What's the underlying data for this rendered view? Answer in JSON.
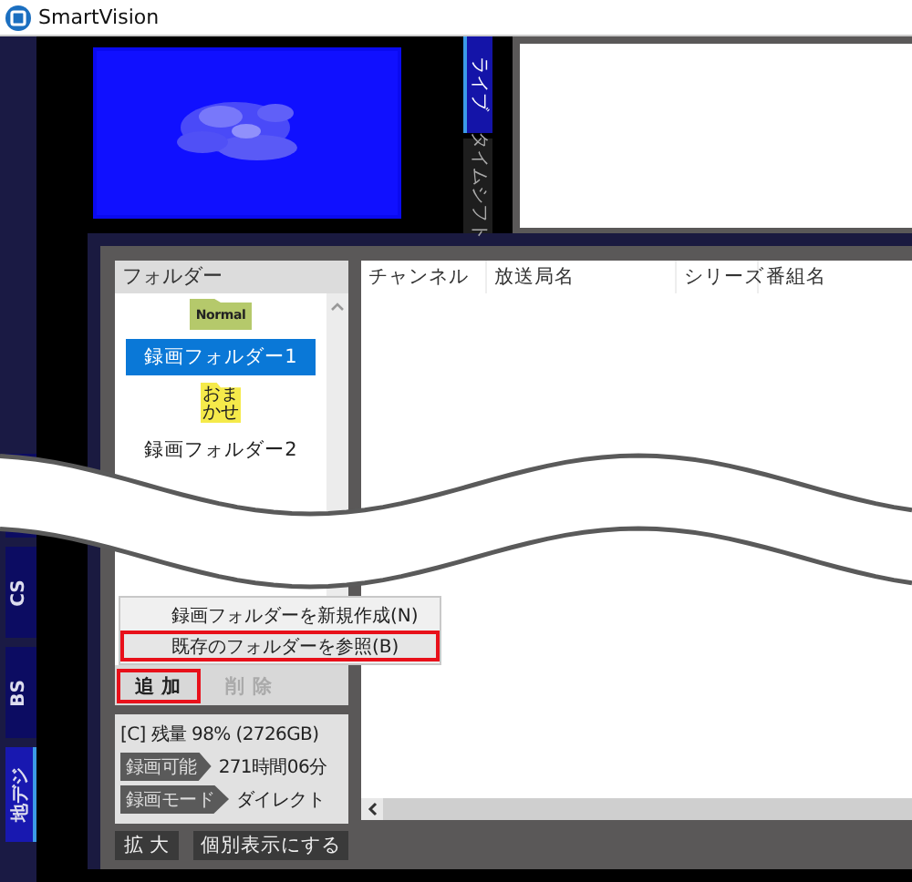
{
  "window": {
    "title": "SmartVision"
  },
  "broadcast_tabs": [
    {
      "label": "CS",
      "selected": false
    },
    {
      "label": "BS",
      "selected": false
    },
    {
      "label": "地デジ",
      "selected": true
    }
  ],
  "viewer": {
    "tabs": [
      {
        "label": "ライブ",
        "selected": true
      },
      {
        "label": "タイムシフト",
        "selected": false
      }
    ]
  },
  "folders": {
    "title": "フォルダー",
    "items": [
      {
        "icon_label": "Normal",
        "color": "#b5c96b",
        "name": "録画フォルダー1",
        "selected": true
      },
      {
        "icon_label": "おまかせ",
        "color": "#f5ea4a",
        "name": "録画フォルダー2",
        "selected": false
      }
    ],
    "context_menu": [
      {
        "label": "録画フォルダーを新規作成(N)",
        "highlighted": false
      },
      {
        "label": "既存のフォルダーを参照(B)",
        "highlighted": true
      }
    ],
    "buttons": [
      {
        "label": "追 加",
        "disabled": false,
        "highlighted": true
      },
      {
        "label": "削 除",
        "disabled": true,
        "highlighted": false
      }
    ]
  },
  "storage": {
    "summary": "[C]  残量 98% (2726GB)",
    "rows": [
      {
        "badge": "録画可能",
        "value": "271時間06分"
      },
      {
        "badge": "録画モード",
        "value": "ダイレクト"
      }
    ]
  },
  "bottom_buttons": [
    "拡 大",
    "個別表示にする"
  ],
  "table": {
    "columns": [
      "チャンネル",
      "放送局名",
      "シリーズ",
      "番組名"
    ]
  }
}
